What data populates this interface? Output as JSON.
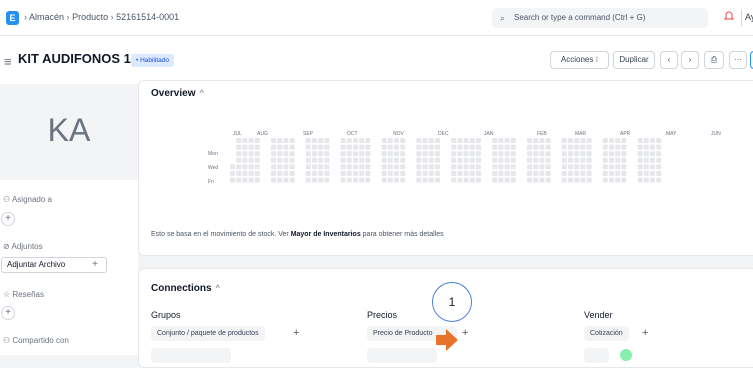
{
  "topbar": {
    "logo": "E",
    "breadcrumbs": [
      "Almacén",
      "Producto",
      "52161514-0001"
    ],
    "search_placeholder": "Search or type a command (Ctrl + G)",
    "help": "Ayuda"
  },
  "header": {
    "title": "KIT AUDIFONOS 1",
    "status": "Habilitado",
    "actions_label": "Acciones",
    "duplicate_label": "Duplicar"
  },
  "sidebar": {
    "avatar_initials": "KA",
    "assigned_label": "Asignado a",
    "attachments_label": "Adjuntos",
    "attach_button": "Adjuntar Archivo",
    "reviews_label": "Reseñas",
    "shared_label": "Compartido con"
  },
  "overview": {
    "title": "Overview",
    "months": [
      "JUL",
      "AUG",
      "SEP",
      "OCT",
      "NOV",
      "DEC",
      "JAN",
      "FEB",
      "MAR",
      "APR",
      "MAY",
      "JUN"
    ],
    "days": [
      "Mon",
      "Wed",
      "Fri"
    ],
    "note_prefix": "Esto se basa en el movimiento de stock. Ver ",
    "note_link": "Mayor de Inventarios",
    "note_suffix": " para obtener más detalles"
  },
  "connections": {
    "title": "Connections",
    "groups_title": "Grupos",
    "groups_item": "Conjunto / paquete de productos",
    "prices_title": "Precios",
    "prices_item": "Precio de Producto",
    "sell_title": "Vender",
    "sell_item": "Cotización"
  },
  "annotation": {
    "number": "1",
    "color": "#e8742a"
  },
  "colors": {
    "accent": "#2490ef",
    "heat_empty": "#e5e7eb"
  }
}
